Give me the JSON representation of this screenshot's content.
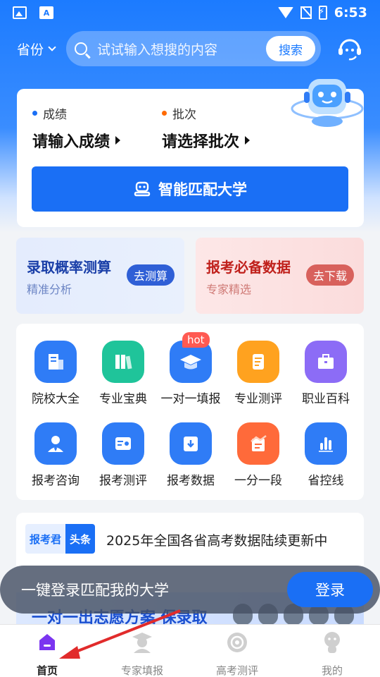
{
  "status_bar": {
    "time": "6:53"
  },
  "header": {
    "province_label": "省份",
    "search_placeholder": "试试输入想搜的内容",
    "search_button": "搜索"
  },
  "match_card": {
    "score_label": "成绩",
    "score_value": "请输入成绩",
    "batch_label": "批次",
    "batch_value": "请选择批次",
    "match_button": "智能匹配大学",
    "score_dot_color": "#1a6ff5",
    "batch_dot_color": "#ff6a00"
  },
  "promos": [
    {
      "title": "录取概率测算",
      "subtitle": "精准分析",
      "button": "去测算",
      "title_color": "#1a3fa8",
      "sub_color": "#6b84c4",
      "btn_color": "#2f5fd6"
    },
    {
      "title": "报考必备数据",
      "subtitle": "专家精选",
      "button": "去下载",
      "title_color": "#c0211c",
      "sub_color": "#cf7a76",
      "btn_color": "#d8615c"
    }
  ],
  "grid": [
    {
      "label": "院校大全",
      "icon": "building-icon",
      "color": "#2f7cf6"
    },
    {
      "label": "专业宝典",
      "icon": "books-icon",
      "color": "#1fc49a"
    },
    {
      "label": "一对一填报",
      "icon": "graduation-cap-icon",
      "color": "#2f7cf6",
      "badge": "hot"
    },
    {
      "label": "专业测评",
      "icon": "scroll-icon",
      "color": "#ffa21f"
    },
    {
      "label": "职业百科",
      "icon": "briefcase-icon",
      "color": "#8c6cf6"
    },
    {
      "label": "报考咨询",
      "icon": "advisor-icon",
      "color": "#2f7cf6"
    },
    {
      "label": "报考测评",
      "icon": "test-icon",
      "color": "#2f7cf6"
    },
    {
      "label": "报考数据",
      "icon": "download-folder-icon",
      "color": "#2f7cf6"
    },
    {
      "label": "一分一段",
      "icon": "chart-doc-icon",
      "color": "#ff6a3a"
    },
    {
      "label": "省控线",
      "icon": "bar-chart-icon",
      "color": "#2f7cf6"
    }
  ],
  "news": {
    "badge_a": "报考君",
    "badge_b": "头条",
    "text": "2025年全国各省高考数据陆续更新中"
  },
  "banner": {
    "text": "一对一出志愿方案 保录取"
  },
  "login_bar": {
    "text": "一键登录匹配我的大学",
    "button": "登录"
  },
  "bottom_nav": [
    {
      "label": "首页",
      "icon": "home-icon",
      "active": true
    },
    {
      "label": "专家填报",
      "icon": "expert-icon",
      "active": false
    },
    {
      "label": "高考测评",
      "icon": "assessment-icon",
      "active": false
    },
    {
      "label": "我的",
      "icon": "profile-icon",
      "active": false
    }
  ]
}
